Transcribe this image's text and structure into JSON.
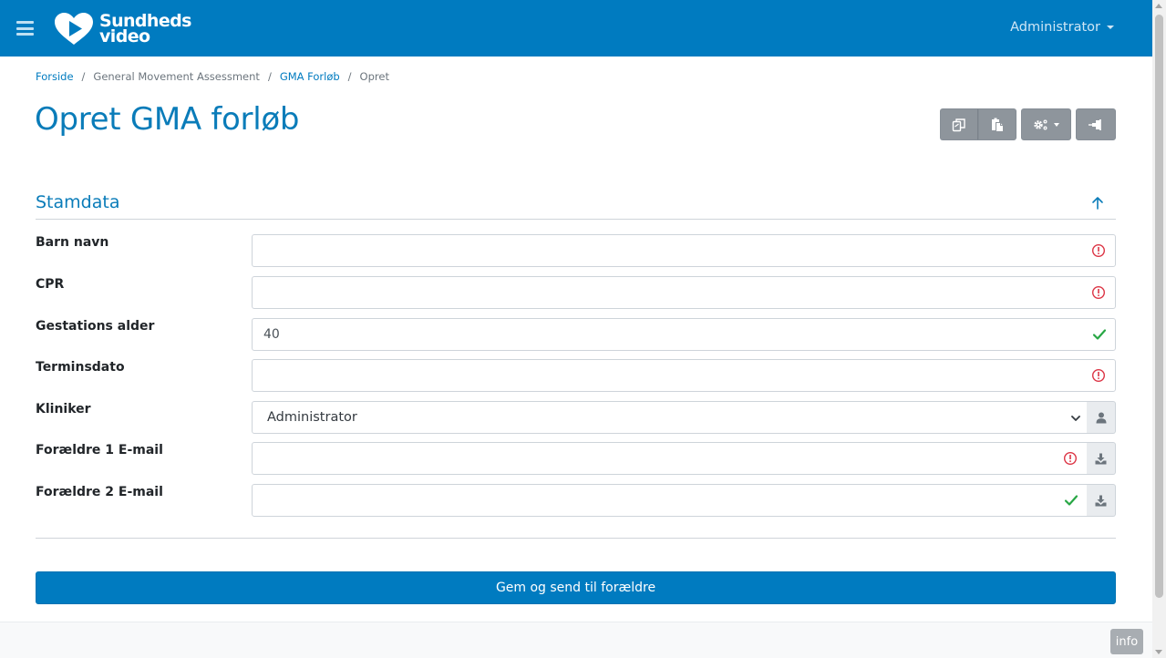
{
  "navbar": {
    "logo_line1": "Sundheds",
    "logo_line2": "video",
    "user_menu_label": "Administrator",
    "bg_color": "#007bc0"
  },
  "breadcrumb": [
    {
      "label": "Forside",
      "link": true
    },
    {
      "label": "General Movement Assessment",
      "link": false
    },
    {
      "label": "GMA Forløb",
      "link": true
    },
    {
      "label": "Opret",
      "link": false
    }
  ],
  "page": {
    "title": "Opret GMA forløb"
  },
  "toolbar": {
    "icons": [
      "copy-icon",
      "paste-icon",
      "gears-icon",
      "pin-icon"
    ]
  },
  "section": {
    "title": "Stamdata"
  },
  "form": {
    "fields": [
      {
        "label": "Barn navn",
        "value": "",
        "status": "error"
      },
      {
        "label": "CPR",
        "value": "",
        "status": "error"
      },
      {
        "label": "Gestations alder",
        "value": "40",
        "status": "valid"
      },
      {
        "label": "Terminsdato",
        "value": "",
        "status": "error"
      },
      {
        "label": "Kliniker",
        "value": "Administrator",
        "status": "select"
      },
      {
        "label": "Forældre 1 E-mail",
        "value": "",
        "status": "error"
      },
      {
        "label": "Forældre 2 E-mail",
        "value": "",
        "status": "valid"
      }
    ]
  },
  "submit": {
    "label": "Gem og send til forældre"
  },
  "footer": {
    "info_label": "info"
  },
  "colors": {
    "brand": "#007bc0",
    "error": "#dc3545",
    "valid": "#28a745",
    "toolbar_gray": "#8e959c"
  }
}
